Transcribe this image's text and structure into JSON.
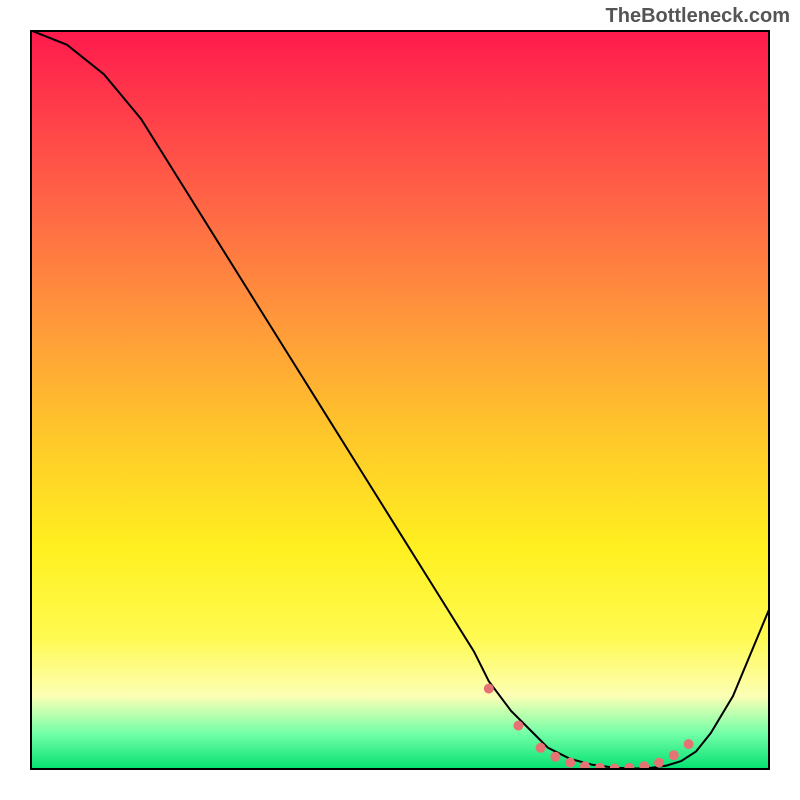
{
  "watermark": "TheBottleneck.com",
  "chart_data": {
    "type": "line",
    "title": "",
    "xlabel": "",
    "ylabel": "",
    "ylim": [
      0,
      100
    ],
    "xlim": [
      0,
      100
    ],
    "series": [
      {
        "name": "bottleneck-curve",
        "x": [
          0,
          5,
          10,
          15,
          20,
          25,
          30,
          35,
          40,
          45,
          50,
          55,
          60,
          62,
          65,
          68,
          70,
          73,
          76,
          79,
          82,
          84,
          86,
          88,
          90,
          92,
          95,
          100
        ],
        "y": [
          100,
          98,
          94,
          88,
          80,
          72,
          64,
          56,
          48,
          40,
          32,
          24,
          16,
          12,
          8,
          5,
          3,
          1.5,
          0.7,
          0.3,
          0.2,
          0.3,
          0.6,
          1.2,
          2.5,
          5,
          10,
          22
        ]
      }
    ],
    "markers": {
      "name": "highlight-dots",
      "x": [
        62,
        66,
        69,
        71,
        73,
        75,
        77,
        79,
        81,
        83,
        85,
        87,
        89
      ],
      "y": [
        11,
        6,
        3,
        1.8,
        1.0,
        0.5,
        0.3,
        0.2,
        0.3,
        0.5,
        1.0,
        2.0,
        3.5
      ]
    }
  }
}
